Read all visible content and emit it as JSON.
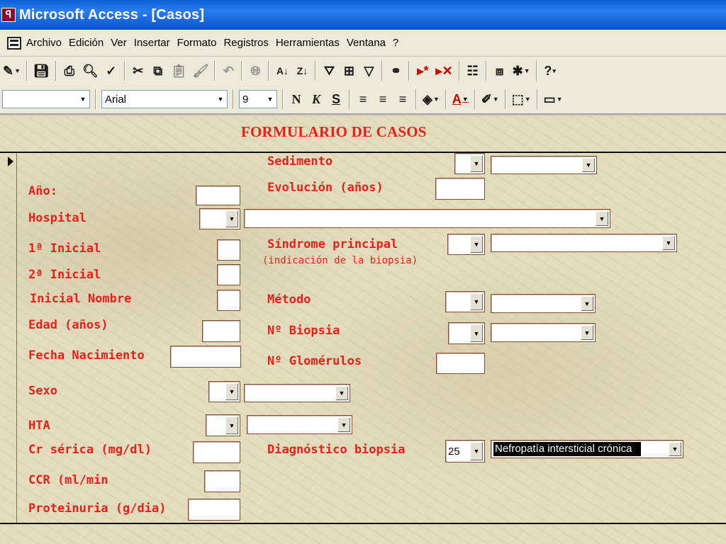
{
  "window": {
    "title": "Microsoft Access - [Casos]",
    "icon": "access-key-icon"
  },
  "menu": {
    "items": [
      "Archivo",
      "Edición",
      "Ver",
      "Insertar",
      "Formato",
      "Registros",
      "Herramientas",
      "Ventana",
      "?"
    ]
  },
  "toolbar2": {
    "font_name": "Arial",
    "font_size": "9",
    "object_value": ""
  },
  "form": {
    "title": "FORMULARIO DE CASOS",
    "labels": {
      "sedimento": "Sedimento",
      "ano": "Año:",
      "evolucion": "Evolución (años)",
      "hospital": "Hospital",
      "inicial1": "1ª Inicial",
      "sindrome": "Síndrome principal",
      "sindrome_sub": "(indicación de la biopsia)",
      "inicial2": "2ª Inicial",
      "inicial_nombre": "Inicial Nombre",
      "metodo": "Método",
      "edad": "Edad (años)",
      "n_biopsia": "Nº Biopsia",
      "fecha_nac": "Fecha Nacimiento",
      "n_glomerulos": "Nº Glomérulos",
      "sexo": "Sexo",
      "hta": "HTA",
      "cr_serica": "Cr sérica (mg/dl)",
      "diagnostico": "Diagnóstico biopsia",
      "ccr": "CCR (ml/min",
      "proteinuria": "Proteinuria (g/dia)"
    },
    "values": {
      "diagnostico_code": "25",
      "diagnostico_text": "Nefropatía intersticial crónica"
    }
  },
  "colors": {
    "label_red": "#e8201c",
    "form_background": "#e2dbbc",
    "titlebar_blue": "#0a5fd8"
  }
}
